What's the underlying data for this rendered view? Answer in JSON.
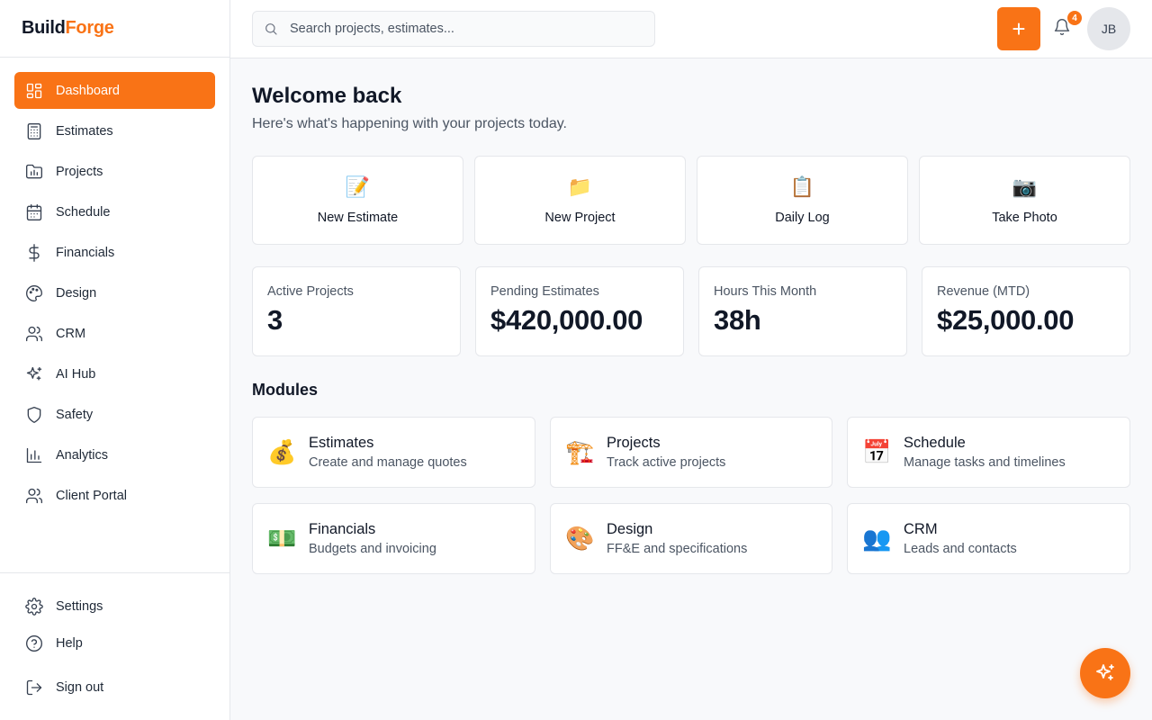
{
  "brand": {
    "part1": "Build",
    "part2": "Forge",
    "accent_color": "#f97316"
  },
  "sidebar": {
    "items": [
      {
        "label": "Dashboard",
        "icon": "dashboard-icon",
        "active": true
      },
      {
        "label": "Estimates",
        "icon": "calculator-icon"
      },
      {
        "label": "Projects",
        "icon": "folder-chart-icon"
      },
      {
        "label": "Schedule",
        "icon": "calendar-icon"
      },
      {
        "label": "Financials",
        "icon": "dollar-icon"
      },
      {
        "label": "Design",
        "icon": "palette-icon"
      },
      {
        "label": "CRM",
        "icon": "users-icon"
      },
      {
        "label": "AI Hub",
        "icon": "sparkles-icon"
      },
      {
        "label": "Safety",
        "icon": "shield-icon"
      },
      {
        "label": "Analytics",
        "icon": "bar-chart-icon"
      },
      {
        "label": "Client Portal",
        "icon": "users-icon"
      }
    ],
    "bottom": [
      {
        "label": "Settings",
        "icon": "gear-icon"
      },
      {
        "label": "Help",
        "icon": "help-circle-icon"
      },
      {
        "label": "Sign out",
        "icon": "sign-out-icon"
      }
    ]
  },
  "header": {
    "search_placeholder": "Search projects, estimates...",
    "add_label": "+",
    "notification_count": "4",
    "avatar_initials": "JB"
  },
  "main": {
    "title": "Welcome back",
    "subtitle": "Here's what's happening with your projects today.",
    "quick_actions": [
      {
        "label": "New Estimate",
        "icon": "📝"
      },
      {
        "label": "New Project",
        "icon": "📁"
      },
      {
        "label": "Daily Log",
        "icon": "📋"
      },
      {
        "label": "Take Photo",
        "icon": "📷"
      }
    ],
    "stats": [
      {
        "label": "Active Projects",
        "value": "3"
      },
      {
        "label": "Pending Estimates",
        "value": "$420,000.00"
      },
      {
        "label": "Hours This Month",
        "value": "38h"
      },
      {
        "label": "Revenue (MTD)",
        "value": "$25,000.00"
      }
    ],
    "modules_title": "Modules",
    "modules": [
      {
        "title": "Estimates",
        "desc": "Create and manage quotes",
        "icon": "💰"
      },
      {
        "title": "Projects",
        "desc": "Track active projects",
        "icon": "🏗️"
      },
      {
        "title": "Schedule",
        "desc": "Manage tasks and timelines",
        "icon": "📅"
      },
      {
        "title": "Financials",
        "desc": "Budgets and invoicing",
        "icon": "💵"
      },
      {
        "title": "Design",
        "desc": "FF&E and specifications",
        "icon": "🎨"
      },
      {
        "title": "CRM",
        "desc": "Leads and contacts",
        "icon": "👥"
      }
    ]
  }
}
